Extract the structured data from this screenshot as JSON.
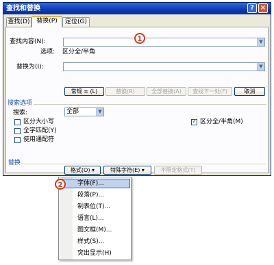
{
  "window": {
    "title": "查找和替换",
    "help_btn": "?",
    "close_btn": "×"
  },
  "tabs": [
    {
      "label": "查找(D)"
    },
    {
      "label": "替换(P)"
    },
    {
      "label": "定位(G)"
    }
  ],
  "find": {
    "label": "查找内容(N):",
    "value": "",
    "options_label": "选项:",
    "options_value": "区分全/半角"
  },
  "replace": {
    "label": "替换为(I):",
    "value": ""
  },
  "buttons": {
    "normal": "常规 ± (L)",
    "replace": "替换(R)",
    "replace_all": "全部替换(A)",
    "find_next": "查找下一处(F)",
    "cancel": "取消"
  },
  "search_options": {
    "title": "搜索选项",
    "search_label": "搜索:",
    "search_value": "全部",
    "match_case": "区分大小写",
    "whole_word": "全字匹配(Y)",
    "wildcards": "使用通配符",
    "half_full": "区分全/半角(M)"
  },
  "replace_section": {
    "title": "替换",
    "format_btn": "格式(O) ▾",
    "special_btn": "特殊字符(E) ▾",
    "no_format_btn": "不限定格式(T)"
  },
  "menu": {
    "items": [
      "字体(F)...",
      "段落(P)...",
      "制表位(T)...",
      "语言(L)...",
      "图文框(M)...",
      "样式(S)...",
      "突出显示(H)"
    ]
  },
  "callouts": [
    "1",
    "2"
  ],
  "colors": {
    "title_bar": "#0c3ab6",
    "accent": "#1f53b8",
    "callout": "#d23a1e"
  }
}
